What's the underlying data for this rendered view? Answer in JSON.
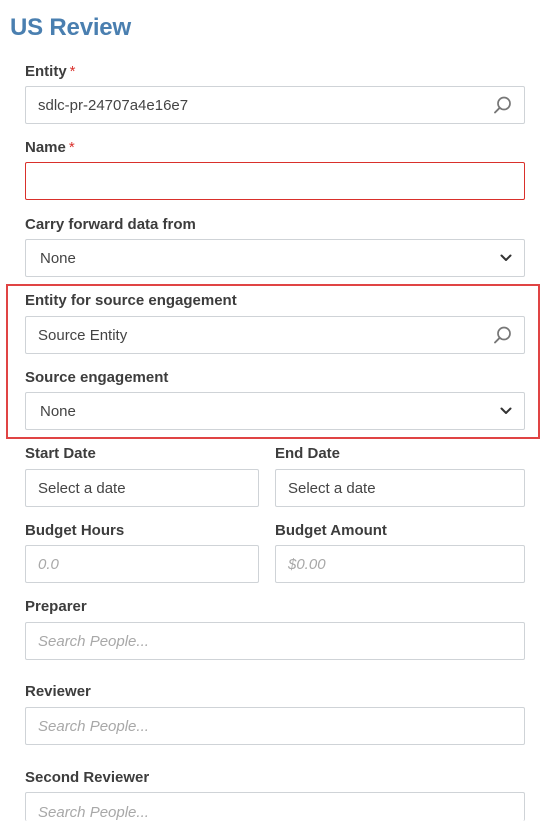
{
  "page": {
    "title": "US Review"
  },
  "entity": {
    "label": "Entity",
    "required_mark": "*",
    "value": "sdlc-pr-24707a4e16e7"
  },
  "name": {
    "label": "Name",
    "required_mark": "*",
    "value": ""
  },
  "carry_forward": {
    "label": "Carry forward data from",
    "selected": "None"
  },
  "source_entity": {
    "label": "Entity for source engagement",
    "value": "Source Entity"
  },
  "source_engagement": {
    "label": "Source engagement",
    "selected": "None"
  },
  "start_date": {
    "label": "Start Date",
    "placeholder": "Select a date"
  },
  "end_date": {
    "label": "End Date",
    "placeholder": "Select a date"
  },
  "budget_hours": {
    "label": "Budget Hours",
    "placeholder": "0.0"
  },
  "budget_amount": {
    "label": "Budget Amount",
    "placeholder": "$0.00"
  },
  "preparer": {
    "label": "Preparer",
    "placeholder": "Search People..."
  },
  "reviewer": {
    "label": "Reviewer",
    "placeholder": "Search People..."
  },
  "second_reviewer": {
    "label": "Second Reviewer",
    "placeholder": "Search People..."
  },
  "icons": {
    "search": "search-icon",
    "dropdown": "chevron-down-icon"
  },
  "colors": {
    "title": "#4a7fb0",
    "required": "#d9302b",
    "highlight_border": "#e04444",
    "error_border": "#d9302b"
  }
}
